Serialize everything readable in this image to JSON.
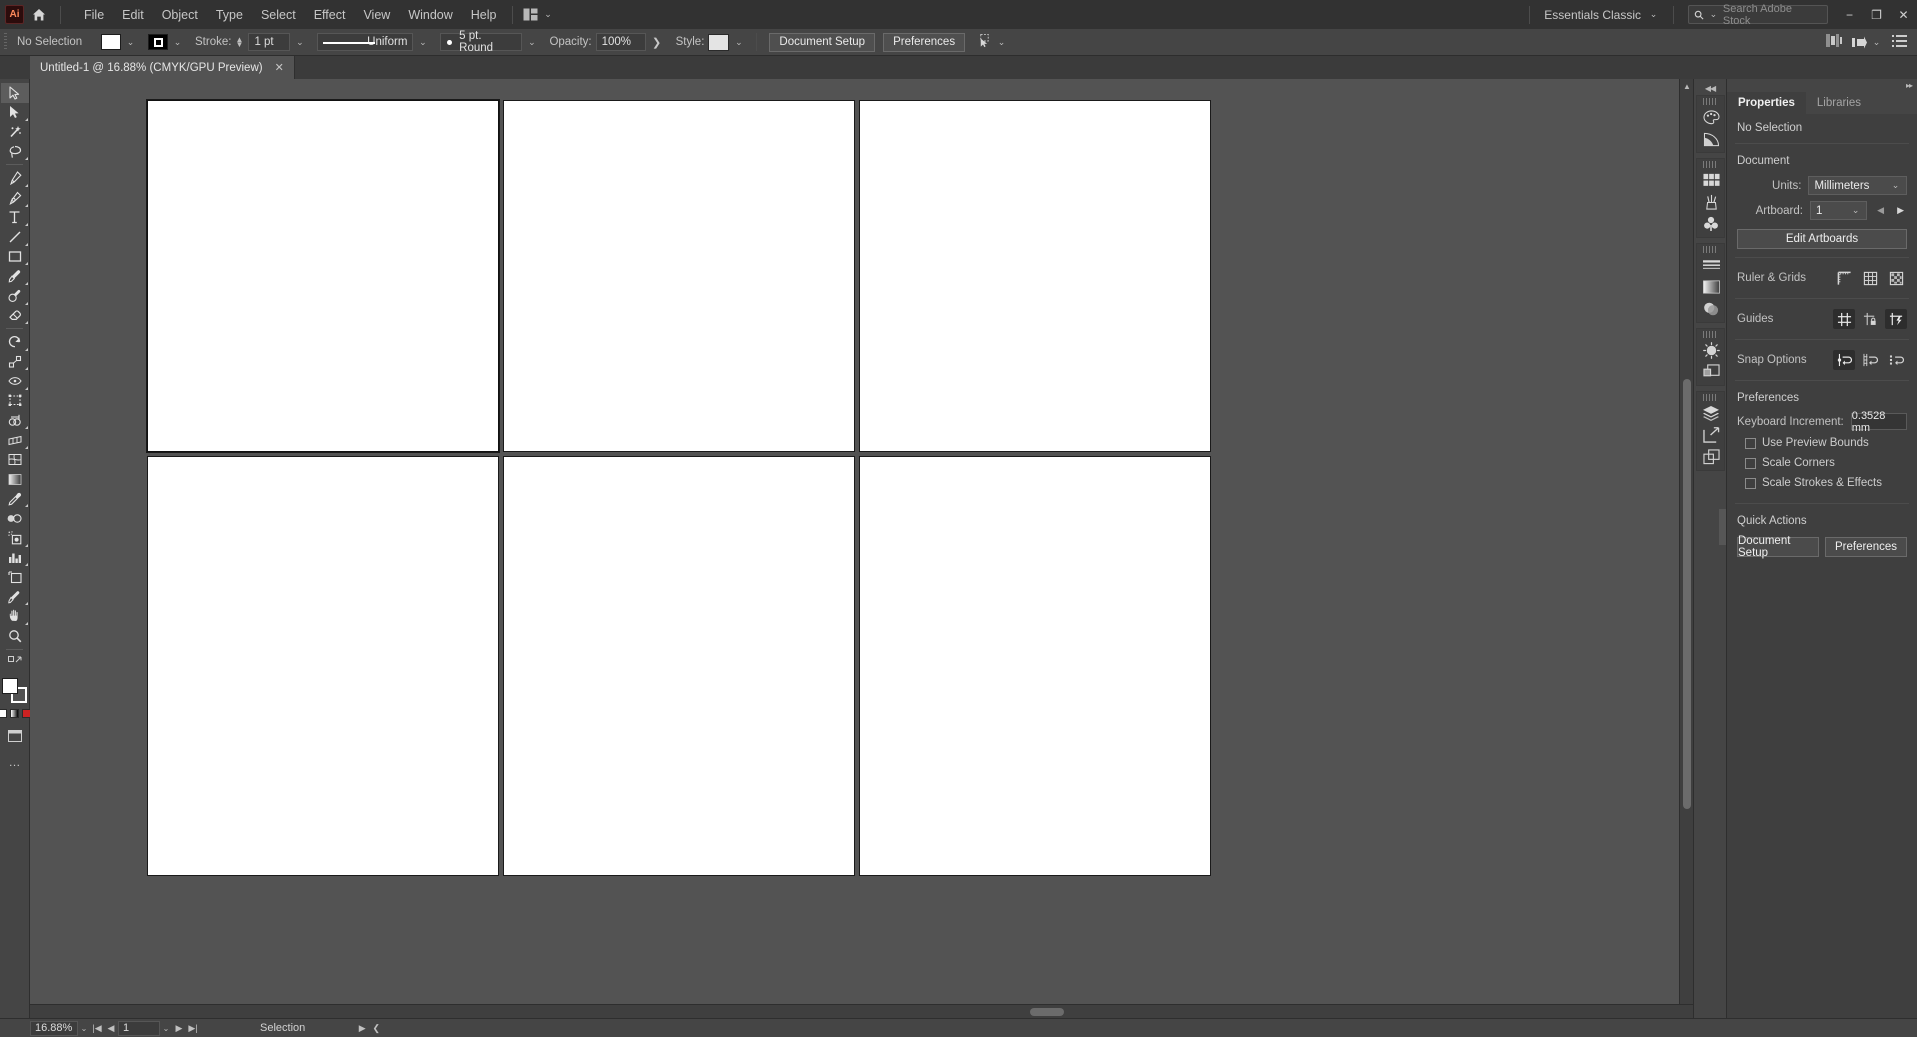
{
  "app": {
    "name": "Adobe Illustrator",
    "logo_text": "Ai"
  },
  "menubar": {
    "home_icon": "home-icon",
    "items": [
      "File",
      "Edit",
      "Object",
      "Type",
      "Select",
      "Effect",
      "View",
      "Window",
      "Help"
    ],
    "arrange_icon": "arrange-documents-icon",
    "workspace": {
      "label": "Essentials Classic",
      "caret": "⌄"
    },
    "search": {
      "placeholder": "Search Adobe Stock",
      "icon": "search-icon",
      "caret": "⌄"
    },
    "window_buttons": {
      "minimize": "−",
      "restore": "❐",
      "close": "✕"
    }
  },
  "controlbar": {
    "selection_status": "No Selection",
    "fill_swatch_caret": "⌄",
    "stroke_swatch_caret": "⌄",
    "stroke_label": "Stroke:",
    "stroke_weight": "1 pt",
    "stroke_weight_caret": "⌄",
    "stroke_profile": "Uniform",
    "stroke_profile_caret": "⌄",
    "brush_definition": "5 pt. Round",
    "brush_caret": "⌄",
    "opacity_label": "Opacity:",
    "opacity_value": "100%",
    "opacity_more": "❯",
    "style_label": "Style:",
    "style_caret": "⌄",
    "document_setup": "Document Setup",
    "preferences": "Preferences",
    "select_similar_icon": "select-similar-objects-icon",
    "select_similar_caret": "⌄",
    "align_icon": "align-icon",
    "distribute_icon": "distribute-icon",
    "distribute_caret": "⌄",
    "options_icon": "panel-options-icon"
  },
  "tabbar": {
    "tabs": [
      {
        "title": "Untitled-1 @ 16.88% (CMYK/GPU Preview)",
        "close": "✕",
        "active": true
      }
    ]
  },
  "toolbar": {
    "tools": [
      {
        "name": "selection-tool",
        "selected": false,
        "has_flyout": false
      },
      {
        "name": "direct-selection-tool",
        "selected": false,
        "has_flyout": true
      },
      {
        "name": "magic-wand-tool",
        "selected": false,
        "has_flyout": false
      },
      {
        "name": "lasso-tool",
        "selected": false,
        "has_flyout": false
      },
      {
        "name": "pen-tool",
        "selected": false,
        "has_flyout": true
      },
      {
        "name": "curvature-tool",
        "selected": false,
        "has_flyout": false
      },
      {
        "name": "type-tool",
        "selected": false,
        "has_flyout": true
      },
      {
        "name": "line-segment-tool",
        "selected": false,
        "has_flyout": true
      },
      {
        "name": "rectangle-tool",
        "selected": false,
        "has_flyout": true
      },
      {
        "name": "paintbrush-tool",
        "selected": false,
        "has_flyout": true
      },
      {
        "name": "shaper-tool",
        "selected": false,
        "has_flyout": true
      },
      {
        "name": "eraser-tool",
        "selected": false,
        "has_flyout": true
      },
      {
        "name": "rotate-tool",
        "selected": false,
        "has_flyout": true
      },
      {
        "name": "scale-tool",
        "selected": false,
        "has_flyout": true
      },
      {
        "name": "width-tool",
        "selected": false,
        "has_flyout": true
      },
      {
        "name": "free-transform-tool",
        "selected": false,
        "has_flyout": false
      },
      {
        "name": "shape-builder-tool",
        "selected": false,
        "has_flyout": true
      },
      {
        "name": "perspective-grid-tool",
        "selected": false,
        "has_flyout": true
      },
      {
        "name": "mesh-tool",
        "selected": false,
        "has_flyout": false
      },
      {
        "name": "gradient-tool",
        "selected": false,
        "has_flyout": false
      },
      {
        "name": "eyedropper-tool",
        "selected": false,
        "has_flyout": true
      },
      {
        "name": "blend-tool",
        "selected": false,
        "has_flyout": false
      },
      {
        "name": "symbol-sprayer-tool",
        "selected": false,
        "has_flyout": true
      },
      {
        "name": "column-graph-tool",
        "selected": false,
        "has_flyout": true
      },
      {
        "name": "artboard-tool",
        "selected": false,
        "has_flyout": false
      },
      {
        "name": "slice-tool",
        "selected": false,
        "has_flyout": true
      },
      {
        "name": "hand-tool",
        "selected": false,
        "has_flyout": true
      },
      {
        "name": "zoom-tool",
        "selected": false,
        "has_flyout": false
      }
    ],
    "fill_color": "#ffffff",
    "stroke_color": "#000000",
    "more_tools": "…"
  },
  "canvas": {
    "artboards": [
      {
        "id": 1,
        "active": true
      },
      {
        "id": 2,
        "active": false
      },
      {
        "id": 3,
        "active": false
      },
      {
        "id": 4,
        "active": false
      },
      {
        "id": 5,
        "active": false
      },
      {
        "id": 6,
        "active": false
      }
    ]
  },
  "statusbar": {
    "zoom_level": "16.88%",
    "zoom_caret": "⌄",
    "first_artboard": "|◀",
    "prev_artboard": "◀",
    "artboard_number": "1",
    "artboard_caret": "⌄",
    "next_artboard": "▶",
    "last_artboard": "▶|",
    "current_tool": "Selection",
    "status_caret": "▶",
    "expand_caret": "❮"
  },
  "rail": {
    "collapse_icon": "collapse-panels-icon",
    "groups": [
      {
        "icons": [
          "color-panel-icon",
          "color-guide-panel-icon"
        ]
      },
      {
        "icons": [
          "swatches-panel-icon",
          "brushes-panel-icon",
          "symbols-panel-icon"
        ]
      },
      {
        "icons": [
          "stroke-panel-icon",
          "gradient-panel-icon",
          "transparency-panel-icon"
        ]
      },
      {
        "icons": [
          "appearance-panel-icon",
          "graphic-styles-panel-icon"
        ]
      },
      {
        "icons": [
          "layers-panel-icon",
          "artboards-panel-icon",
          "asset-export-panel-icon"
        ]
      }
    ]
  },
  "panel": {
    "collapse_icon": "collapse-to-icons-icon",
    "tabs": [
      {
        "label": "Properties",
        "active": true
      },
      {
        "label": "Libraries",
        "active": false
      }
    ],
    "selection_status": "No Selection",
    "document": {
      "title": "Document",
      "units_label": "Units:",
      "units_value": "Millimeters",
      "units_caret": "⌄",
      "artboard_label": "Artboard:",
      "artboard_value": "1",
      "artboard_caret": "⌄",
      "prev_icon": "prev-artboard-icon",
      "next_icon": "next-artboard-icon",
      "edit_artboards": "Edit Artboards"
    },
    "ruler_grids": {
      "label": "Ruler & Grids",
      "icons": [
        "show-rulers-icon",
        "show-grid-icon",
        "show-transparency-grid-icon"
      ]
    },
    "guides": {
      "label": "Guides",
      "icons": [
        "show-guides-icon",
        "lock-guides-icon",
        "smart-guides-icon"
      ],
      "active": [
        true,
        false,
        true
      ]
    },
    "snap_options": {
      "label": "Snap Options",
      "icons": [
        "snap-to-point-icon",
        "snap-to-grid-icon",
        "snap-to-pixel-icon"
      ],
      "active": [
        true,
        false,
        false
      ]
    },
    "preferences": {
      "title": "Preferences",
      "keyboard_increment_label": "Keyboard Increment:",
      "keyboard_increment_value": "0.3528 mm",
      "checkboxes": [
        {
          "label": "Use Preview Bounds",
          "checked": false
        },
        {
          "label": "Scale Corners",
          "checked": false
        },
        {
          "label": "Scale Strokes & Effects",
          "checked": false
        }
      ]
    },
    "quick_actions": {
      "title": "Quick Actions",
      "buttons": [
        "Document Setup",
        "Preferences"
      ]
    }
  },
  "colors": {
    "chrome": "#454545",
    "menubar": "#323232",
    "panel": "#3f3f3f",
    "canvas": "#535353",
    "text": "#c9c9c9",
    "accent": "#ff8a5c"
  }
}
